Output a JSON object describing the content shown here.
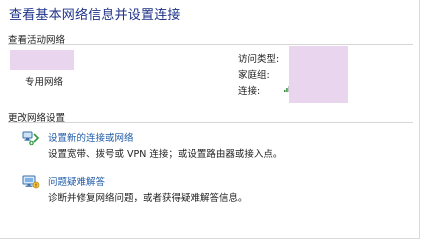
{
  "page": {
    "title": "查看基本网络信息并设置连接"
  },
  "active_networks": {
    "header": "查看活动网络",
    "network_type": "专用网络",
    "props": [
      {
        "label": "访问类型:"
      },
      {
        "label": "家庭组:"
      },
      {
        "label": "连接:"
      }
    ],
    "signal_icon": "signal-bars-icon"
  },
  "change_settings": {
    "header": "更改网络设置",
    "actions": [
      {
        "icon": "network-connection-icon",
        "link": "设置新的连接或网络",
        "desc": "设置宽带、拨号或 VPN 连接；或设置路由器或接入点。"
      },
      {
        "icon": "troubleshoot-icon",
        "link": "问题疑难解答",
        "desc": "诊断并修复网络问题，或者获得疑难解答信息。"
      }
    ]
  },
  "colors": {
    "title": "#1e3287",
    "link": "#1e5aa8",
    "redaction": "#e9d6ee"
  }
}
